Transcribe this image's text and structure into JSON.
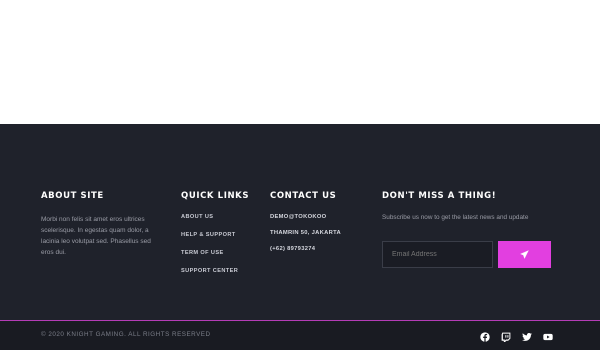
{
  "footer": {
    "about": {
      "heading": "ABOUT SITE",
      "text": "Morbi non felis sit amet eros ultrices scelerisque. In egestas quam dolor, a lacinia leo volutpat sed. Phasellus sed eros dui."
    },
    "quick_links": {
      "heading": "QUICK LINKS",
      "items": [
        "ABOUT US",
        "HELP & SUPPORT",
        "TERM OF USE",
        "SUPPORT CENTER"
      ]
    },
    "contact": {
      "heading": "CONTACT US",
      "email": "DEMO@TOKOKOO",
      "address": "THAMRIN 50, JAKARTA",
      "phone": "(+62) 89793274"
    },
    "newsletter": {
      "heading": "DON'T MISS A THING!",
      "text": "Subscribe us now to get the latest news and update",
      "email_placeholder": "Email Address",
      "send_icon": "paper-plane-icon"
    },
    "copyright": "© 2020 KNIGHT GAMING. ALL RIGHTS RESERVED",
    "social": [
      "facebook-icon",
      "twitch-icon",
      "twitter-icon",
      "youtube-icon"
    ],
    "colors": {
      "background": "#1f222b",
      "accent": "#e23fe0",
      "bottom_bar": "#191b22"
    }
  }
}
